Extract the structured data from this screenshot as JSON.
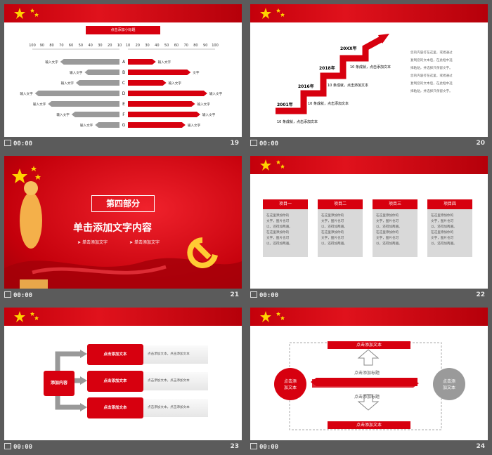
{
  "footer": {
    "time": "00:00"
  },
  "s19": {
    "number": "19",
    "title": "点击添加小标题",
    "scale_left": [
      "100",
      "90",
      "80",
      "70",
      "60",
      "50",
      "40",
      "30",
      "20",
      "10"
    ],
    "scale_right": [
      "10",
      "20",
      "30",
      "40",
      "50",
      "60",
      "70",
      "80",
      "90",
      "100"
    ],
    "rows": [
      {
        "letter": "A",
        "left_label": "输入文字",
        "right_label": "输入文字",
        "lv": 0.68,
        "rv": 0.32
      },
      {
        "letter": "B",
        "left_label": "输入文字",
        "right_label": "文字",
        "lv": 0.4,
        "rv": 0.72
      },
      {
        "letter": "C",
        "left_label": "输入文字",
        "right_label": "输入文字",
        "lv": 0.5,
        "rv": 0.44
      },
      {
        "letter": "D",
        "left_label": "输入文字",
        "right_label": "输入文字",
        "lv": 0.97,
        "rv": 0.91
      },
      {
        "letter": "E",
        "left_label": "输入文字",
        "right_label": "输入文字",
        "lv": 0.82,
        "rv": 0.77
      },
      {
        "letter": "F",
        "left_label": "输入文字",
        "right_label": "输入文字",
        "lv": 0.55,
        "rv": 0.83
      },
      {
        "letter": "G",
        "left_label": "输入文字",
        "right_label": "输入文字",
        "lv": 0.28,
        "rv": 0.66
      }
    ]
  },
  "s20": {
    "number": "20",
    "years": [
      "2001年",
      "2016年",
      "2018年",
      "20XX年"
    ],
    "steps": [
      "10 条成就，点击添加文本",
      "10 条成就，点击添加文本",
      "10 条成就，点击添加文本",
      "10 条成就，点击添加文本"
    ],
    "paragraph": [
      "您的内容打在这里，或者通过",
      "复制您的文本后，在此框中选",
      "择粘贴，并选择只保留文字。",
      "您的内容打在这里，或者通过",
      "复制您的文本后，在此框中选",
      "择粘贴，并选择只保留文字。"
    ]
  },
  "s21": {
    "number": "21",
    "part": "第四部分",
    "title": "单击添加文字内容",
    "sub1": "单击添加文字",
    "sub2": "单击添加文字"
  },
  "s22": {
    "number": "22",
    "items": [
      {
        "title": "项目一"
      },
      {
        "title": "项目二"
      },
      {
        "title": "项目三"
      },
      {
        "title": "项目四"
      }
    ],
    "body": [
      "在这里添加你的",
      "文字，图片也可",
      "以，还得加两遍。",
      "在这里添加你的",
      "文字，图片也可",
      "以，还得加两遍。"
    ]
  },
  "s23": {
    "number": "23",
    "center": "添加内容",
    "rows": [
      {
        "label": "点击添加文本",
        "desc": "点击添加文本，点击添加文本"
      },
      {
        "label": "点击添加文本",
        "desc": "点击添加文本，点击添加文本"
      },
      {
        "label": "点击添加文本",
        "desc": "点击添加文本，点击添加文本"
      }
    ]
  },
  "s24": {
    "number": "24",
    "top": "点击添加文本",
    "bottom": "点击添加文本",
    "mid1": "点击添加标题",
    "mid2": "点击添加标题",
    "left_circle": [
      "点击添",
      "加文本"
    ],
    "right_circle": [
      "点击添",
      "加文本"
    ]
  },
  "colors": {
    "red": "#d7000f",
    "gray": "#9a9a9a"
  }
}
